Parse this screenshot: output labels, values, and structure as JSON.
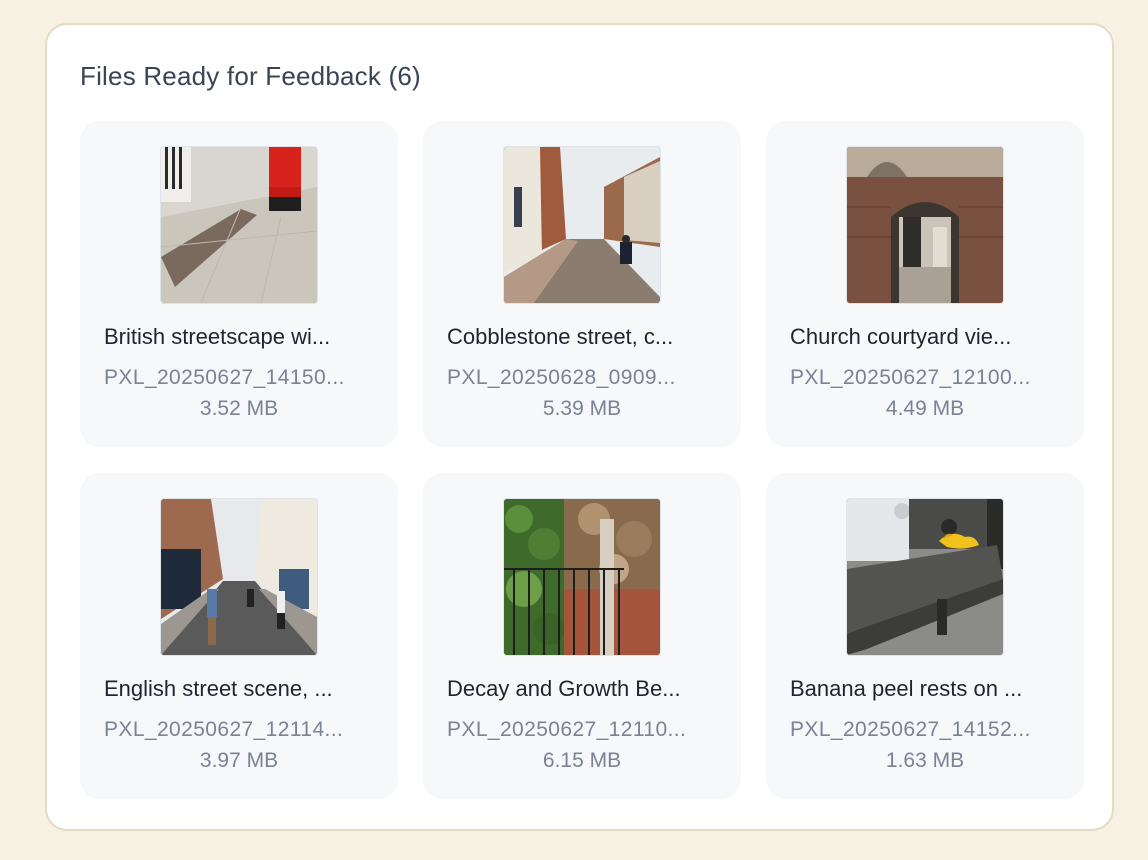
{
  "panel": {
    "title": "Files Ready for Feedback (6)"
  },
  "files": [
    {
      "title": "British streetscape wi...",
      "filename": "PXL_20250627_14150...",
      "size": "3.52 MB",
      "thumbnail": "image-thumbnail-red-postbox-pavement"
    },
    {
      "title": "Cobblestone street, c...",
      "filename": "PXL_20250628_0909...",
      "size": "5.39 MB",
      "thumbnail": "image-thumbnail-cobblestone-street"
    },
    {
      "title": "Church courtyard vie...",
      "filename": "PXL_20250627_12100...",
      "size": "4.49 MB",
      "thumbnail": "image-thumbnail-church-courtyard-arch"
    },
    {
      "title": "English street scene, ...",
      "filename": "PXL_20250627_12114...",
      "size": "3.97 MB",
      "thumbnail": "image-thumbnail-english-street-scene"
    },
    {
      "title": "Decay and Growth Be...",
      "filename": "PXL_20250627_12110...",
      "size": "6.15 MB",
      "thumbnail": "image-thumbnail-ivy-wall-railings"
    },
    {
      "title": "Banana peel rests on ...",
      "filename": "PXL_20250627_14152...",
      "size": "1.63 MB",
      "thumbnail": "image-thumbnail-banana-peel-bench"
    }
  ]
}
